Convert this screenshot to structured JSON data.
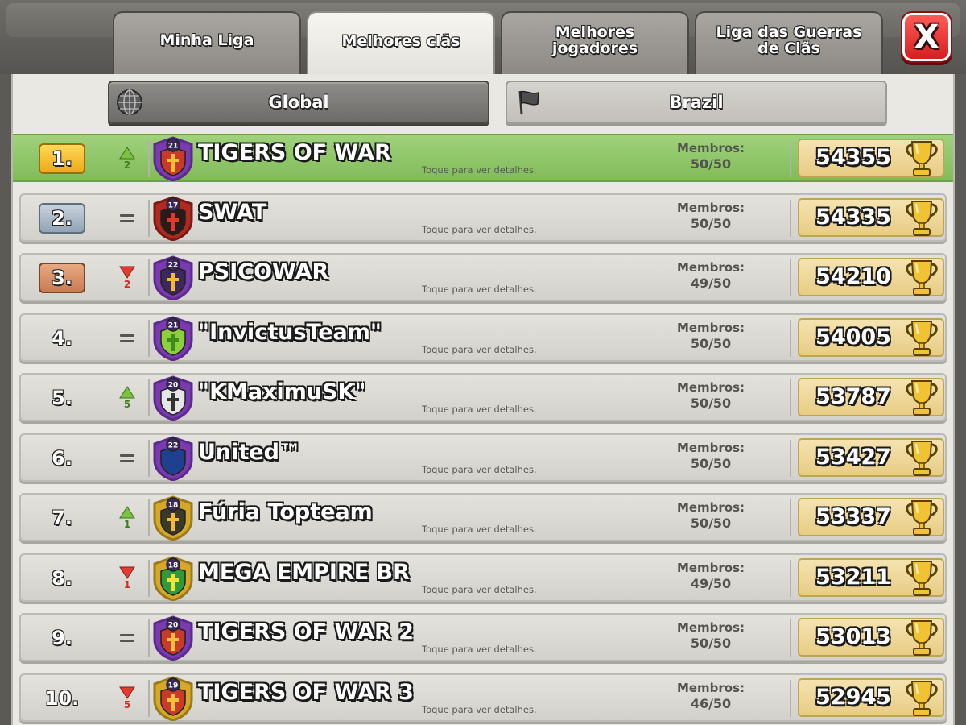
{
  "tabs": [
    {
      "label": "Minha Liga",
      "active": false
    },
    {
      "label": "Melhores clãs",
      "active": true
    },
    {
      "label": "Melhores jogadores",
      "active": false
    },
    {
      "label": "Liga das Guerras de Clãs",
      "active": false
    }
  ],
  "close_label": "X",
  "filters": {
    "global_label": "Global",
    "global_icon": "globe-icon",
    "country_label": "Brazil",
    "country_icon": "flag-icon"
  },
  "members_label": "Membros:",
  "details_hint": "Toque para ver detalhes.",
  "clans": [
    {
      "rank": "1.",
      "change": "up",
      "change_value": "2",
      "badge_level": "21",
      "badge_style": "purple-cross",
      "name": "TIGERS OF WAR",
      "members": "50/50",
      "trophies": "54355"
    },
    {
      "rank": "2.",
      "change": "same",
      "change_value": "",
      "badge_level": "17",
      "badge_style": "red-dark",
      "name": "SWAT",
      "members": "50/50",
      "trophies": "54335"
    },
    {
      "rank": "3.",
      "change": "down",
      "change_value": "2",
      "badge_level": "22",
      "badge_style": "purple-flame",
      "name": "PSICOWAR",
      "members": "49/50",
      "trophies": "54210"
    },
    {
      "rank": "4.",
      "change": "same",
      "change_value": "",
      "badge_level": "21",
      "badge_style": "purple-check-green",
      "name": "\"InvictusTeam\"",
      "members": "50/50",
      "trophies": "54005"
    },
    {
      "rank": "5.",
      "change": "up",
      "change_value": "5",
      "badge_level": "20",
      "badge_style": "purple-check-gray",
      "name": "\"KMaximuSK\"",
      "members": "50/50",
      "trophies": "53787"
    },
    {
      "rank": "6.",
      "change": "same",
      "change_value": "",
      "badge_level": "22",
      "badge_style": "purple-blue",
      "name": "United™",
      "members": "50/50",
      "trophies": "53427"
    },
    {
      "rank": "7.",
      "change": "up",
      "change_value": "1",
      "badge_level": "18",
      "badge_style": "gold-flame",
      "name": "Fúria Topteam",
      "members": "50/50",
      "trophies": "53337"
    },
    {
      "rank": "8.",
      "change": "down",
      "change_value": "1",
      "badge_level": "18",
      "badge_style": "gold-green",
      "name": "MEGA EMPIRE BR",
      "members": "49/50",
      "trophies": "53211"
    },
    {
      "rank": "9.",
      "change": "same",
      "change_value": "",
      "badge_level": "20",
      "badge_style": "purple-cross",
      "name": "TIGERS OF WAR 2",
      "members": "50/50",
      "trophies": "53013"
    },
    {
      "rank": "10.",
      "change": "down",
      "change_value": "5",
      "badge_level": "19",
      "badge_style": "gold-cross",
      "name": "TIGERS OF WAR 3",
      "members": "46/50",
      "trophies": "52945"
    }
  ],
  "colors": {
    "highlight_row": "#8fc66a",
    "up_arrow": "#7cc242",
    "down_arrow": "#e23b32",
    "trophy_gold": "#f1c232"
  }
}
